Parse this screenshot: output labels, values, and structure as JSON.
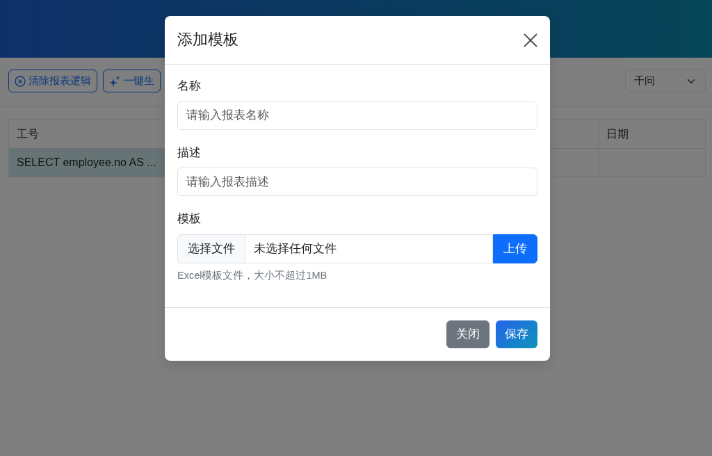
{
  "toolbar": {
    "buttons": [
      {
        "label": "清除报表逻辑",
        "kind": "clear"
      },
      {
        "label": "一键生",
        "kind": "sparkle"
      }
    ],
    "model_select": {
      "value": "千问"
    }
  },
  "table": {
    "columns": [
      {
        "label": "工号"
      },
      {
        "label": "日期"
      }
    ],
    "rows": [
      {
        "cells": [
          "SELECT employee.no AS ..."
        ]
      }
    ]
  },
  "modal": {
    "title": "添加模板",
    "fields": [
      {
        "label": "名称",
        "placeholder": "请输入报表名称"
      },
      {
        "label": "描述",
        "placeholder": "请输入报表描述"
      }
    ],
    "file": {
      "label": "模板",
      "choose_button": "选择文件",
      "status": "未选择任何文件",
      "upload_button": "上传",
      "help": "Excel模板文件，大小不超过1MB"
    },
    "footer_buttons": [
      {
        "label": "关闭",
        "kind": "secondary"
      },
      {
        "label": "保存",
        "kind": "primary"
      }
    ]
  }
}
